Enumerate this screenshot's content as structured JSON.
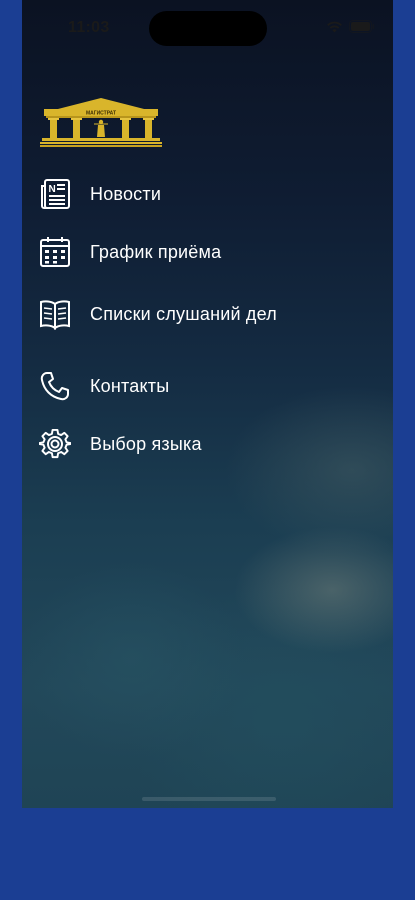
{
  "status_bar": {
    "time": "11:03",
    "icons": [
      "wifi-icon",
      "battery-icon"
    ]
  },
  "app": {
    "logo_text": "МАГИСТРАТ"
  },
  "menu": {
    "items": [
      {
        "icon": "newspaper-icon",
        "label": "Новости"
      },
      {
        "icon": "calendar-icon",
        "label": "График приёма"
      },
      {
        "icon": "book-icon",
        "label": "Списки слушаний дел"
      },
      {
        "icon": "phone-icon",
        "label": "Контакты"
      },
      {
        "icon": "gear-icon",
        "label": "Выбор языка"
      }
    ]
  },
  "colors": {
    "background": "#1b3e93",
    "logo_gold": "#d9b52b",
    "text": "#ffffff"
  }
}
